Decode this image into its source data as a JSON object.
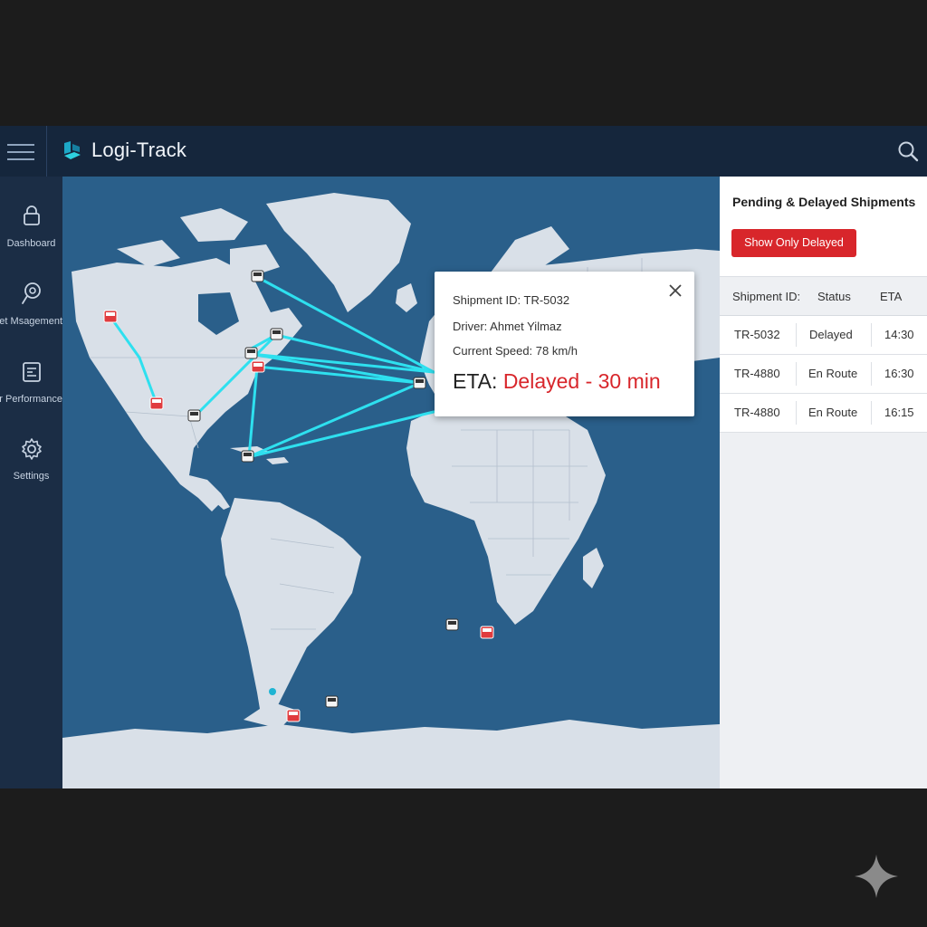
{
  "app": {
    "title": "Logi-Track"
  },
  "sidebar": {
    "items": [
      {
        "label": "Dashboard",
        "icon": "lock-icon"
      },
      {
        "label": "et Msagement",
        "icon": "map-pin-icon"
      },
      {
        "label": "r Performance",
        "icon": "report-icon"
      },
      {
        "label": "Settings",
        "icon": "gear-icon"
      }
    ]
  },
  "popup": {
    "shipment_id": "Shipment ID: TR-5032",
    "driver": "Driver: Ahmet Yilmaz",
    "speed": "Current Speed: 78 km/h",
    "eta_label": "ETA: ",
    "eta_value": "Delayed - 30 min"
  },
  "panel": {
    "title": "Pending & Delayed Shipments",
    "filter_button": "Show Only Delayed",
    "columns": [
      "Shipment ID:",
      "Status",
      "ETA"
    ],
    "rows": [
      {
        "id": "TR-5032",
        "status": "Delayed",
        "eta": "14:30"
      },
      {
        "id": "TR-4880",
        "status": "En Route",
        "eta": "16:30"
      },
      {
        "id": "TR-4880",
        "status": "En Route",
        "eta": "16:15"
      }
    ]
  },
  "colors": {
    "accent_red": "#d8262b",
    "route_cyan": "#2ee0ef",
    "ocean": "#2a5f8a",
    "land": "#d9e0e8"
  }
}
